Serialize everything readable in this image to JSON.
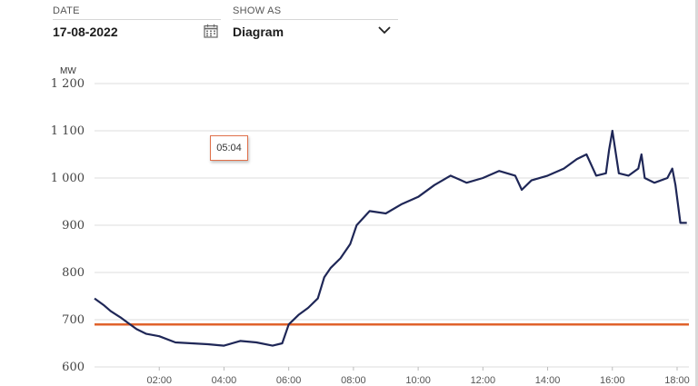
{
  "date_field": {
    "label": "DATE",
    "value": "17-08-2022",
    "icon": "calendar-icon"
  },
  "show_as_field": {
    "label": "SHOW AS",
    "value": "Diagram",
    "icon": "chevron-down-icon"
  },
  "tooltip": {
    "time": "05:04"
  },
  "colors": {
    "line": "#1f2757",
    "reference": "#e0622b",
    "grid": "#dedede",
    "tooltip_border": "#e0704a"
  },
  "chart_data": {
    "type": "line",
    "unit": "MW",
    "y_ticks": [
      "600",
      "700",
      "800",
      "900",
      "1 000",
      "1 100",
      "1 200"
    ],
    "y_tick_values": [
      600,
      700,
      800,
      900,
      1000,
      1100,
      1200
    ],
    "x_ticks": [
      "02:00",
      "04:00",
      "06:00",
      "08:00",
      "10:00",
      "12:00",
      "14:00",
      "16:00",
      "18:00"
    ],
    "x_tick_hours": [
      2,
      4,
      6,
      8,
      10,
      12,
      14,
      16,
      18
    ],
    "xlim_hours": [
      0,
      18.4
    ],
    "ylim": [
      600,
      1200
    ],
    "grid": "horizontal",
    "reference_value": 690,
    "series": [
      {
        "x_hours": [
          0.0,
          0.3,
          0.5,
          0.8,
          1.0,
          1.3,
          1.6,
          2.0,
          2.5,
          3.0,
          3.5,
          4.0,
          4.5,
          5.0,
          5.5,
          5.8,
          6.0,
          6.3,
          6.6,
          6.9,
          7.1,
          7.3,
          7.6,
          7.9,
          8.1,
          8.5,
          9.0,
          9.5,
          10.0,
          10.5,
          11.0,
          11.5,
          12.0,
          12.5,
          13.0,
          13.2,
          13.5,
          14.0,
          14.5,
          14.9,
          15.2,
          15.5,
          15.8,
          15.9,
          16.0,
          16.2,
          16.5,
          16.8,
          16.9,
          17.0,
          17.3,
          17.7,
          17.85,
          17.95,
          18.1,
          18.3
        ],
        "y_mw": [
          745,
          730,
          718,
          705,
          695,
          680,
          670,
          665,
          652,
          650,
          648,
          645,
          655,
          652,
          645,
          650,
          690,
          710,
          725,
          745,
          790,
          810,
          830,
          860,
          900,
          930,
          925,
          945,
          960,
          985,
          1005,
          990,
          1000,
          1015,
          1005,
          975,
          995,
          1005,
          1020,
          1040,
          1050,
          1005,
          1010,
          1060,
          1100,
          1010,
          1005,
          1020,
          1050,
          1000,
          990,
          1000,
          1020,
          985,
          905,
          905
        ]
      }
    ]
  }
}
